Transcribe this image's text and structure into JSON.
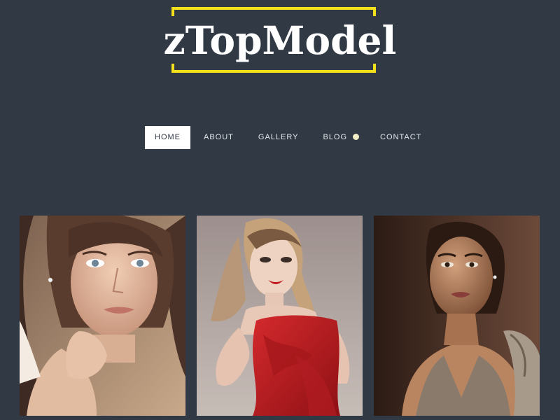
{
  "site": {
    "logo_text": "zTopModel",
    "accent_color": "#f2e11a",
    "background_color": "#303944"
  },
  "nav": {
    "items": [
      {
        "label": "HOME",
        "active": true
      },
      {
        "label": "ABOUT"
      },
      {
        "label": "GALLERY"
      },
      {
        "label": "BLOG"
      },
      {
        "label": "CONTACT"
      }
    ]
  },
  "gallery": {
    "photos": [
      {
        "icon": "portrait-photo-1"
      },
      {
        "icon": "portrait-photo-2"
      },
      {
        "icon": "portrait-photo-3"
      }
    ]
  }
}
